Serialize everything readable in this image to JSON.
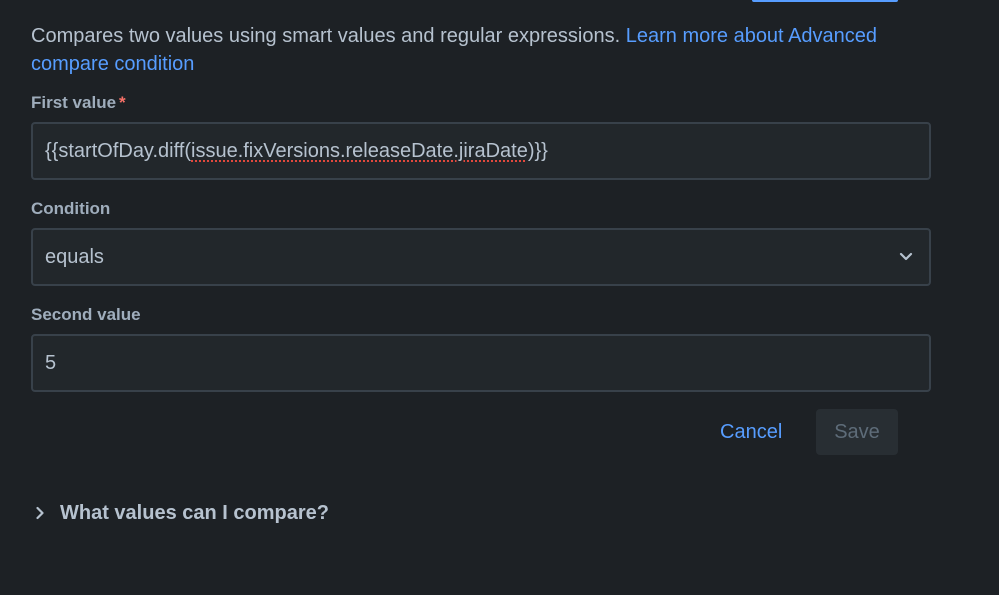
{
  "description": {
    "text": "Compares two values using smart values and regular expressions. ",
    "link_text": "Learn more about Advanced compare condition"
  },
  "first_value": {
    "label": "First value",
    "required_mark": "*",
    "value_prefix": "{{startOfDay.diff(",
    "value_underlined": "issue.fixVersions.releaseDate.jiraDate",
    "value_suffix": ")}}"
  },
  "condition": {
    "label": "Condition",
    "selected": "equals",
    "icon": "chevron-down-icon"
  },
  "second_value": {
    "label": "Second value",
    "value": "5"
  },
  "actions": {
    "cancel_label": "Cancel",
    "save_label": "Save"
  },
  "help": {
    "label": "What values can I compare?",
    "icon": "chevron-right-icon"
  },
  "colors": {
    "background": "#1d2125",
    "link": "#579dff",
    "required": "#f87168",
    "field_border": "#38414a"
  }
}
